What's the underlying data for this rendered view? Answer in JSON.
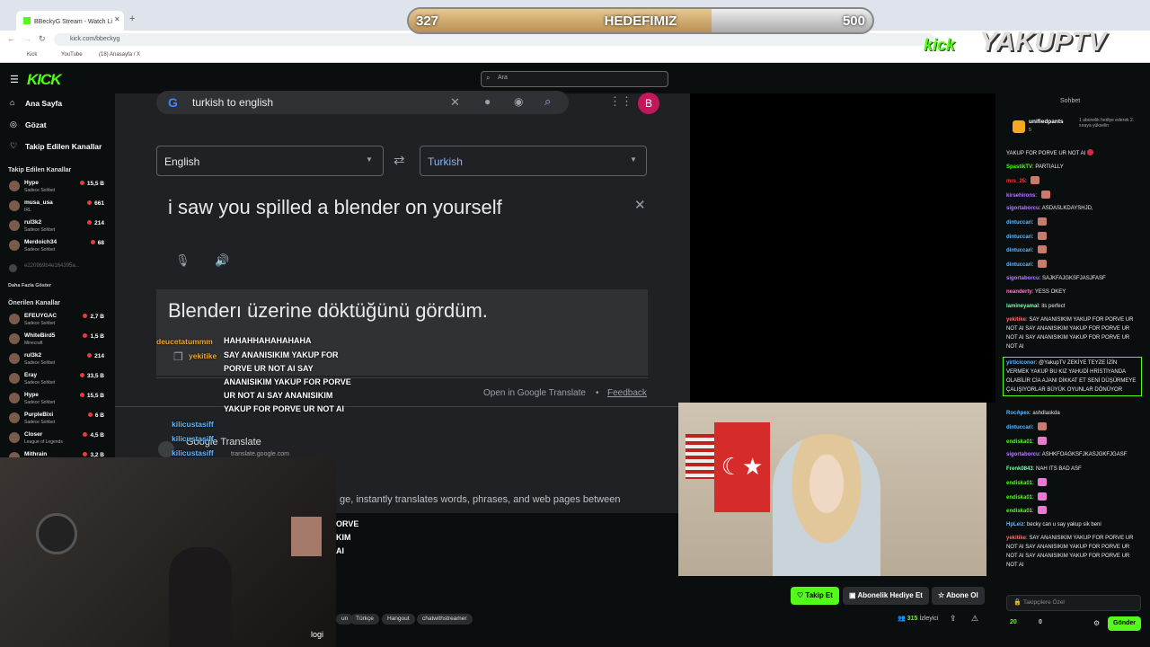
{
  "browser": {
    "tab_title": "BBeckyG Stream - Watch Li",
    "url": "kick.com/bbeckyg",
    "bookmarks": [
      "Kick",
      "YouTube",
      "(18) Anasayfa / X"
    ]
  },
  "site": {
    "logo": "KICK",
    "search_placeholder": "Ara"
  },
  "nav": {
    "home": "Ana Sayfa",
    "browse": "Gözat",
    "following": "Takip Edilen Kanallar"
  },
  "sidebar": {
    "followed_title": "Takip Edilen Kanallar",
    "followed": [
      {
        "name": "Hype",
        "cat": "Sadece Sohbet",
        "viewers": "15,5 B"
      },
      {
        "name": "musa_usa",
        "cat": "IRL",
        "viewers": "661"
      },
      {
        "name": "rul3k2",
        "cat": "Sadece Sohbet",
        "viewers": "214"
      },
      {
        "name": "Merdoich34",
        "cat": "Sadece Sohbet",
        "viewers": "68"
      }
    ],
    "offline": "e2209b9b4e164395a...",
    "more": "Daha Fazla Göster",
    "recommended_title": "Önerilen Kanallar",
    "recommended": [
      {
        "name": "EFEUYGAC",
        "cat": "Sadece Sohbet",
        "viewers": "2,7 B"
      },
      {
        "name": "WhiteBird5",
        "cat": "Minecraft",
        "viewers": "1,5 B"
      },
      {
        "name": "rul3k2",
        "cat": "Sadece Sohbet",
        "viewers": "214"
      },
      {
        "name": "Eray",
        "cat": "Sadece Sohbet",
        "viewers": "33,5 B"
      },
      {
        "name": "Hype",
        "cat": "Sadece Sohbet",
        "viewers": "15,5 B"
      },
      {
        "name": "PurpleBixi",
        "cat": "Sadece Sohbet",
        "viewers": "6 B"
      },
      {
        "name": "Closer",
        "cat": "League of Legends",
        "viewers": "4,5 B"
      },
      {
        "name": "Mithrain",
        "cat": "",
        "viewers": "3,2 B"
      }
    ]
  },
  "translate": {
    "query": "turkish to english",
    "avatar": "B",
    "source_lang": "English",
    "target_lang": "Turkish",
    "source_text": "i saw you spilled a blender on yourself",
    "output_text": "Blenderı üzerine döktüğünü gördüm.",
    "open_link": "Open in Google Translate",
    "feedback": "Feedback",
    "result_title": "Google Translate",
    "result_url": "translate.google.com",
    "snippet": "ge, instantly translates words, phrases, and web pages between"
  },
  "tts": {
    "user1": "deucetatummm",
    "msg1": "HAHAHHAHAHAHAHA",
    "user2": "yekitike",
    "msg2": "SAY ANANISIKIM YAKUP FOR PORVE UR NOT AI SAY ANANISIKIM YAKUP FOR PORVE UR NOT AI SAY ANANISIKIM YAKUP FOR PORVE UR NOT AI",
    "user3": "kilicustasiff",
    "tail": [
      "ORVE",
      "KIM",
      "AI"
    ]
  },
  "goal": {
    "current": "327",
    "label": "HEDEFIMIZ",
    "target": "500",
    "progress": 0.654
  },
  "brand": {
    "kick": "kick",
    "name": "YAKUPTV"
  },
  "chat": {
    "title": "Sohbet",
    "pinned_user": "unifiedpants",
    "pinned_count": "5",
    "pinned_text": "1 abonelik hediye ederek 2. sıraya yükselin",
    "messages": [
      {
        "user": "",
        "text": "YAKUP FOR PORVE UR NOT AI",
        "color": "#ffffff"
      },
      {
        "user": "SpastikTV",
        "text": "PARTIALLY",
        "color": "#53fc18"
      },
      {
        "user": "mrs_25",
        "text": "",
        "color": "#e93b3b"
      },
      {
        "user": "kirsehirons",
        "text": "",
        "color": "#b67cff"
      },
      {
        "user": "sigortaborcu",
        "text": "ASDASLKDAYSHJD,",
        "color": "#b67cff"
      },
      {
        "user": "dintuccari",
        "text": "",
        "color": "#5fb8ff"
      },
      {
        "user": "dintuccari",
        "text": "",
        "color": "#5fb8ff"
      },
      {
        "user": "dintuccari",
        "text": "",
        "color": "#5fb8ff"
      },
      {
        "user": "dintuccari",
        "text": "",
        "color": "#5fb8ff"
      },
      {
        "user": "sigortaborcu",
        "text": "SAJKFAJGKSFJASJFASF",
        "color": "#b67cff"
      },
      {
        "user": "neanderty",
        "text": "YESS OKEY",
        "color": "#ff7ccf"
      },
      {
        "user": "lamineyamal",
        "text": "its perfect",
        "color": "#7cffb0"
      },
      {
        "user": "yekitike",
        "text": "SAY ANANISIKIM YAKUP FOR PORVE UR NOT AI SAY ANANISIKIM YAKUP FOR PORVE UR NOT AI SAY ANANISIKIM YAKUP FOR PORVE UR NOT AI",
        "color": "#ff6b6b"
      },
      {
        "user": "yirticiconor",
        "text": "@YakupTV ZEKİYE TEYZE İZİN VERMEK YAKUP BU KIZ YAHUDİ HRİSTİYANDA OLABİLİR CİA AJANI DİKKAT ET SENİ DÜŞÜRMEYE ÇALIŞIYORLAR BÜYÜK OYUNLAR DÖNÜYOR",
        "color": "#5fb8ff"
      },
      {
        "user": "RocApex",
        "text": "ashdlaskda",
        "color": "#5fb8ff"
      },
      {
        "user": "dintuccari",
        "text": "",
        "color": "#5fb8ff"
      },
      {
        "user": "endiska01",
        "text": "",
        "color": "#53fc18"
      },
      {
        "user": "sigortaborcu",
        "text": "ASHKFOAGKSFJKASJGKFJGASF",
        "color": "#b67cff"
      },
      {
        "user": "Frenk0843",
        "text": "NAH ITS BAD ASF",
        "color": "#7cffb0"
      },
      {
        "user": "endiska01",
        "text": "",
        "color": "#53fc18"
      },
      {
        "user": "endiska01",
        "text": "",
        "color": "#53fc18"
      },
      {
        "user": "endiska01",
        "text": "",
        "color": "#53fc18"
      },
      {
        "user": "HpLeiz",
        "text": "becky can u say yakup sik beni",
        "color": "#5fb8ff"
      },
      {
        "user": "yekitike",
        "text": "SAY ANANISIKIM YAKUP FOR PORVE UR NOT AI SAY ANANISIKIM YAKUP FOR PORVE UR NOT AI SAY ANANISIKIM YAKUP FOR PORVE UR NOT AI",
        "color": "#ff6b6b"
      }
    ],
    "input_placeholder": "Takipçilere Özel",
    "send": "Gönder",
    "points": "20",
    "credits": "0"
  },
  "actions": {
    "follow": "Takip Et",
    "gift": "Abonelik Hediye Et",
    "subscribe": "Abone Ol",
    "viewers": "315",
    "viewers_label": "İzleyici"
  },
  "tags": [
    "un",
    "Türkçe",
    "Hangout",
    "chatwithstreamer"
  ],
  "misc": {
    "login": "logi"
  },
  "colors": {
    "kick_green": "#53fc18",
    "google_bar": "#303134",
    "bg": "#0b0e0f"
  }
}
